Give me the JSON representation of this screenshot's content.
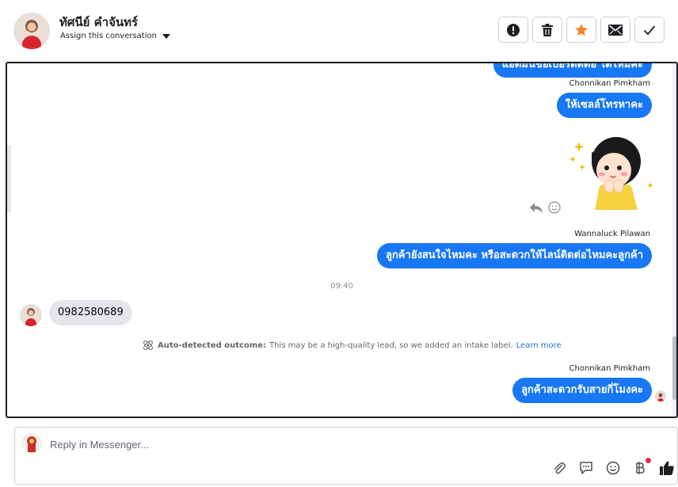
{
  "header": {
    "contact_name": "ทัศนีย์ คำจันทร์",
    "assign_label": "Assign this conversation",
    "actions": [
      "alert-icon",
      "trash-icon",
      "star-icon",
      "mail-icon",
      "check-icon"
    ]
  },
  "conversation": {
    "messages_top": [
      {
        "text": "แอดมินขอเบอร์ติดต่อ ได้ไหมคะ"
      }
    ],
    "sender_1": "Chonnikan Pimkham",
    "msg_sale": "ให้เซลล์โทรหาคะ",
    "sender_2": "Wannaluck Pilawan",
    "msg_interest": "ลูกค้ายังสนใจไหมคะ หรือสะดวกให้ไลน์ติดต่อไหมคะลูกค้า",
    "time": "09:40",
    "incoming": "0982580689",
    "outcome_label": "Auto-detected outcome:",
    "outcome_text": "This may be a high-quality lead, so we added an intake label.",
    "outcome_link": "Learn more",
    "sender_3": "Chonnikan Pimkham",
    "msg_time": "ลูกค้าสะดวกรับสายกี่โมงคะ"
  },
  "reply": {
    "placeholder": "Reply in Messenger...",
    "tools": [
      "attachment-icon",
      "saved-reply-icon",
      "emoji-icon",
      "baht-icon",
      "like-icon"
    ]
  },
  "colors": {
    "accent": "#1877f2",
    "incoming_bubble": "#e4e6eb",
    "star": "#f5822a",
    "link": "#216fdb"
  }
}
